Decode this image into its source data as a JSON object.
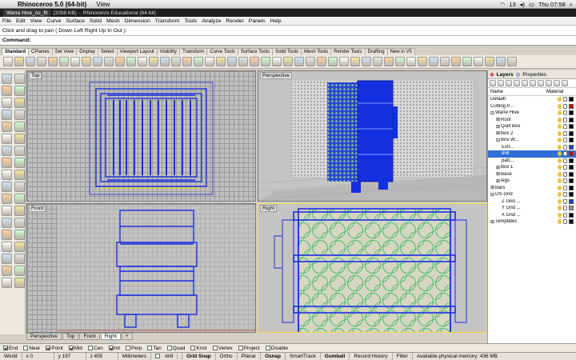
{
  "os": {
    "app": "Rhinoceros 5.0 (64-bit)",
    "menu": [
      "View"
    ],
    "right": {
      "battery": "13",
      "clock": "Thu 07:58"
    }
  },
  "window": {
    "tab": "Warre Hive_os_flt",
    "size": "(2058 KB)",
    "title": "Rhinoceros Educational (64-bit)"
  },
  "menu": [
    "File",
    "Edit",
    "View",
    "Curve",
    "Surface",
    "Solid",
    "Mesh",
    "Dimension",
    "Transform",
    "Tools",
    "Analyze",
    "Render",
    "Panels",
    "Help"
  ],
  "command": {
    "history": "Click and drag to pan ( Down  Left  Right  Up  In  Out ):",
    "label": "Command:",
    "value": ""
  },
  "tabs": [
    "Standard",
    "CPlanes",
    "Set View",
    "Display",
    "Select",
    "Viewport Layout",
    "Visibility",
    "Transform",
    "Curve Tools",
    "Surface Tools",
    "Solid Tools",
    "Mesh Tools",
    "Render Tools",
    "Drafting",
    "New in V5"
  ],
  "active_tab": "Standard",
  "viewports": {
    "top": "Top",
    "perspective": "Perspective",
    "front": "Front",
    "right": "Right"
  },
  "viewport_tabs": [
    "Perspective",
    "Top",
    "Front",
    "Right"
  ],
  "viewport_tab_active": "Right",
  "add_tab": "+",
  "osnap": [
    {
      "label": "End",
      "on": true
    },
    {
      "label": "Near",
      "on": false
    },
    {
      "label": "Point",
      "on": true
    },
    {
      "label": "Mid",
      "on": true
    },
    {
      "label": "Cen",
      "on": false
    },
    {
      "label": "Int",
      "on": true
    },
    {
      "label": "Perp",
      "on": false
    },
    {
      "label": "Tan",
      "on": false
    },
    {
      "label": "Quad",
      "on": false
    },
    {
      "label": "Knot",
      "on": false
    },
    {
      "label": "Vertex",
      "on": false
    },
    {
      "label": "Project",
      "on": false
    },
    {
      "label": "Disable",
      "on": false
    }
  ],
  "status": {
    "cplane": "World",
    "x": "x 0",
    "y": "y 197",
    "z": "z 455",
    "units": "Millimeters",
    "layer": "drill",
    "buttons": [
      "Grid Snap",
      "Ortho",
      "Planar",
      "Osnap",
      "SmartTrack",
      "Gumball",
      "Record History",
      "Filter"
    ],
    "memory": "Available physical memory: 436 MB"
  },
  "panel": {
    "tabs": [
      "Layers",
      "Properties"
    ],
    "columns": {
      "name": "Name",
      "material": "Material"
    },
    "layers": [
      {
        "name": "Default",
        "indent": 0,
        "color": "#000000"
      },
      {
        "name": "Cutting P...",
        "indent": 0,
        "color": "#cc0000"
      },
      {
        "name": "Warre Hive",
        "indent": 0,
        "color": "#000000",
        "exp": "⊟"
      },
      {
        "name": "Roof",
        "indent": 1,
        "color": "#000000",
        "exp": "⊞"
      },
      {
        "name": "Quilt Box",
        "indent": 1,
        "color": "#000000",
        "exp": "⊞"
      },
      {
        "name": "Box 2",
        "indent": 1,
        "color": "#000000",
        "exp": "⊞"
      },
      {
        "name": "Box W...",
        "indent": 1,
        "color": "#000000",
        "exp": "⊟"
      },
      {
        "name": "Extr...",
        "indent": 2,
        "color": "#1a3fd6"
      },
      {
        "name": "drill",
        "indent": 2,
        "color": "#cc0000",
        "selected": true
      },
      {
        "name": "patt...",
        "indent": 2,
        "color": "#000000"
      },
      {
        "name": "Box 1",
        "indent": 1,
        "color": "#000000",
        "exp": "⊞"
      },
      {
        "name": "Base",
        "indent": 1,
        "color": "#000000",
        "exp": "⊞"
      },
      {
        "name": "legs",
        "indent": 1,
        "color": "#000000",
        "exp": "⊞"
      },
      {
        "name": "Bars",
        "indent": 0,
        "color": "#000000",
        "exp": "⊞"
      },
      {
        "name": "OS Grid",
        "indent": 0,
        "color": "#000000",
        "exp": "⊟"
      },
      {
        "name": "Z Grid ...",
        "indent": 2,
        "color": "#1a3fd6"
      },
      {
        "name": "Y Grid ...",
        "indent": 2,
        "color": "#999999"
      },
      {
        "name": "X Grid ...",
        "indent": 2,
        "color": "#000000"
      },
      {
        "name": "Templates",
        "indent": 0,
        "color": "#000000",
        "exp": "⊞"
      }
    ]
  }
}
